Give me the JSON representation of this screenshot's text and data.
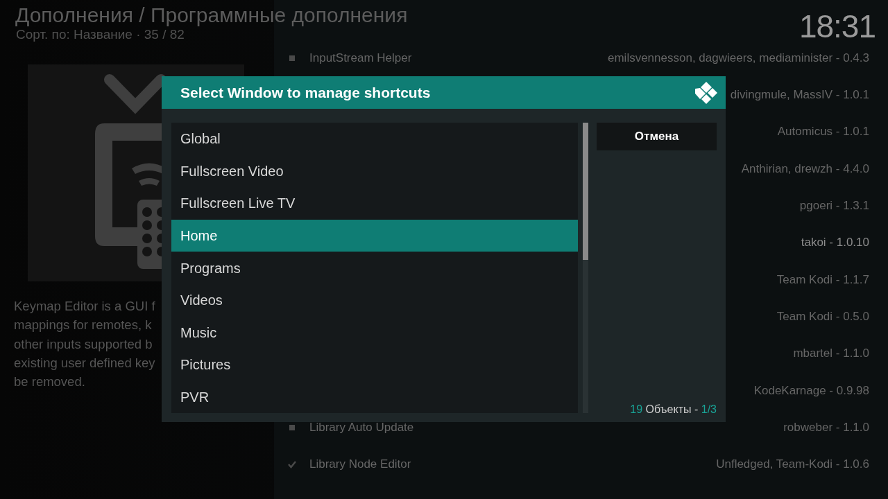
{
  "header": {
    "title": "Дополнения / Программные дополнения",
    "sort": "Сорт. по: Название · 35 / 82"
  },
  "clock": "18:31",
  "description_lines": [
    "Keymap Editor is a GUI f",
    "mappings for remotes, k",
    "other inputs supported b",
    "existing user defined key",
    "be removed."
  ],
  "addons": [
    {
      "name": "InputStream Helper",
      "author": "emilsvennesson, dagwieers, mediaminister - 0.4.3",
      "kind": "bullet",
      "selected": false
    },
    {
      "author": "divingmule, MassIV - 1.0.1",
      "selected": false
    },
    {
      "author": "Automicus - 1.0.1",
      "selected": false
    },
    {
      "author": "Anthirian, drewzh - 4.4.0",
      "selected": false
    },
    {
      "author": "pgoeri - 1.3.1",
      "selected": false
    },
    {
      "author": "takoi - 1.0.10",
      "selected": true
    },
    {
      "author": "Team Kodi - 1.1.7",
      "selected": false
    },
    {
      "author": "Team Kodi - 0.5.0",
      "selected": false
    },
    {
      "author": "mbartel - 1.1.0",
      "selected": false
    },
    {
      "author": "KodeKarnage - 0.9.98",
      "selected": false
    },
    {
      "name": "Library Auto Update",
      "author": "robweber - 1.1.0",
      "kind": "bullet",
      "selected": false
    },
    {
      "name": "Library Node Editor",
      "author": "Unfledged, Team-Kodi - 1.0.6",
      "kind": "check",
      "selected": false
    }
  ],
  "dialog": {
    "title": "Select Window to manage shortcuts",
    "items": [
      {
        "label": "Global",
        "selected": false
      },
      {
        "label": "Fullscreen Video",
        "selected": false
      },
      {
        "label": "Fullscreen Live TV",
        "selected": false
      },
      {
        "label": "Home",
        "selected": true
      },
      {
        "label": "Programs",
        "selected": false
      },
      {
        "label": "Videos",
        "selected": false
      },
      {
        "label": "Music",
        "selected": false
      },
      {
        "label": "Pictures",
        "selected": false
      },
      {
        "label": "PVR",
        "selected": false
      }
    ],
    "cancel_button": "Отмена",
    "footer": {
      "count": "19",
      "label": "Объекты -",
      "page": "1/3"
    }
  }
}
